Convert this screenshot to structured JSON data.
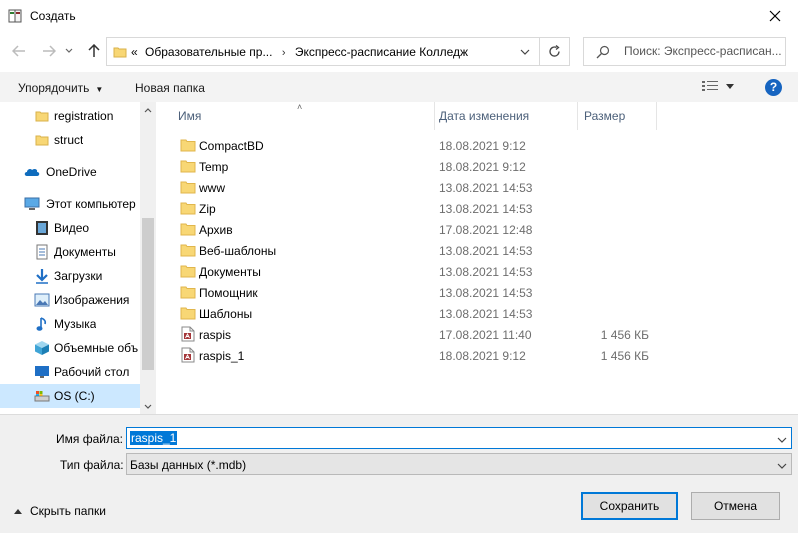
{
  "window": {
    "title": "Создать"
  },
  "address": {
    "overflow": "«",
    "crumbs": [
      "Образовательные пр...",
      "Экспресс-расписание Колледж"
    ]
  },
  "search": {
    "placeholder": "Поиск: Экспресс-расписан..."
  },
  "toolbar": {
    "organize": "Упорядочить",
    "new_folder": "Новая папка"
  },
  "sidebar": {
    "items": [
      {
        "label": "registration",
        "icon": "folder-icon"
      },
      {
        "label": "struct",
        "icon": "folder-icon"
      },
      {
        "label": "OneDrive",
        "icon": "onedrive-icon"
      },
      {
        "label": "Этот компьютер",
        "icon": "computer-icon"
      },
      {
        "label": "Видео",
        "icon": "video-icon"
      },
      {
        "label": "Документы",
        "icon": "documents-icon"
      },
      {
        "label": "Загрузки",
        "icon": "downloads-icon"
      },
      {
        "label": "Изображения",
        "icon": "pictures-icon"
      },
      {
        "label": "Музыка",
        "icon": "music-icon"
      },
      {
        "label": "Объемные объ",
        "icon": "3d-objects-icon"
      },
      {
        "label": "Рабочий стол",
        "icon": "desktop-icon"
      },
      {
        "label": "OS (C:)",
        "icon": "drive-icon",
        "selected": true
      }
    ]
  },
  "columns": {
    "name": "Имя",
    "date": "Дата изменения",
    "size": "Размер"
  },
  "files": [
    {
      "name": "CompactBD",
      "date": "18.08.2021 9:12",
      "size": "",
      "type": "folder"
    },
    {
      "name": "Temp",
      "date": "18.08.2021 9:12",
      "size": "",
      "type": "folder"
    },
    {
      "name": "www",
      "date": "13.08.2021 14:53",
      "size": "",
      "type": "folder"
    },
    {
      "name": "Zip",
      "date": "13.08.2021 14:53",
      "size": "",
      "type": "folder"
    },
    {
      "name": "Архив",
      "date": "17.08.2021 12:48",
      "size": "",
      "type": "folder"
    },
    {
      "name": "Веб-шаблоны",
      "date": "13.08.2021 14:53",
      "size": "",
      "type": "folder"
    },
    {
      "name": "Документы",
      "date": "13.08.2021 14:53",
      "size": "",
      "type": "folder"
    },
    {
      "name": "Помощник",
      "date": "13.08.2021 14:53",
      "size": "",
      "type": "folder"
    },
    {
      "name": "Шаблоны",
      "date": "13.08.2021 14:53",
      "size": "",
      "type": "folder"
    },
    {
      "name": "raspis",
      "date": "17.08.2021 11:40",
      "size": "1 456 КБ",
      "type": "access-db"
    },
    {
      "name": "raspis_1",
      "date": "18.08.2021 9:12",
      "size": "1 456 КБ",
      "type": "access-db"
    }
  ],
  "form": {
    "filename_label": "Имя файла:",
    "filename_value": "raspis_1",
    "filetype_label": "Тип файла:",
    "filetype_value": "Базы данных (*.mdb)"
  },
  "footer": {
    "hide_folders": "Скрыть папки",
    "save": "Сохранить",
    "cancel": "Отмена"
  },
  "colors": {
    "accent": "#0078d7",
    "help": "#1664c0",
    "folder": "#f8d775",
    "selection": "#cce8ff"
  }
}
